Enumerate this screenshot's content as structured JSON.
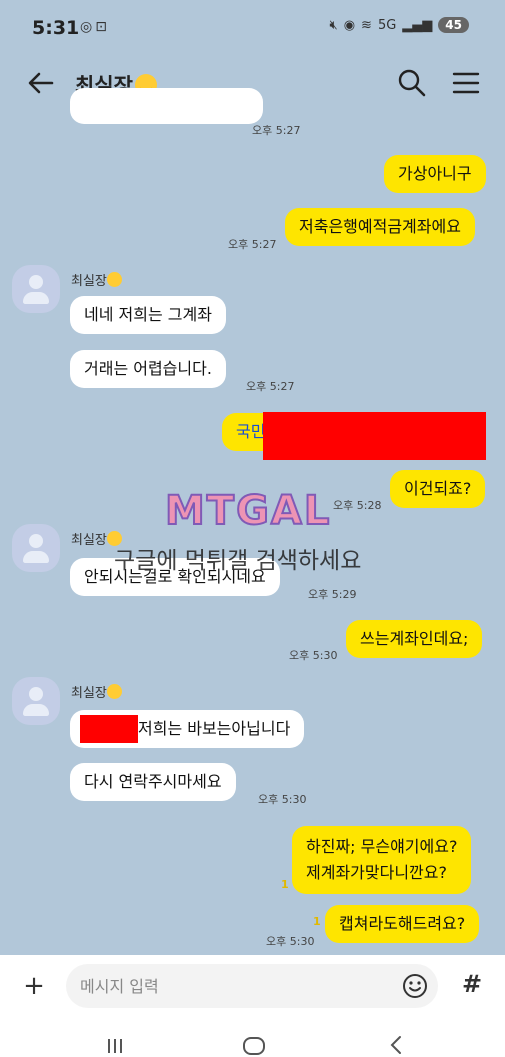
{
  "status_bar": {
    "time": "5:31",
    "left_icons": [
      "chrome-icon",
      "screenshot-icon"
    ],
    "right_icons": [
      "mute-icon",
      "hotspot-icon",
      "wifi-icon",
      "5g-icon",
      "signal-icon"
    ],
    "network": "5G",
    "battery": "45"
  },
  "header": {
    "title": "최실장",
    "icons": [
      "back-arrow-icon",
      "search-icon",
      "menu-icon"
    ]
  },
  "messages": {
    "m0_time": "오후 5:27",
    "m1_text": "가상아니구",
    "m2_text": "저축은행예적금계좌에요",
    "m2_time": "오후 5:27",
    "sender_name": "최실장",
    "m3_text": "네네 저희는 그계좌",
    "m4_text": "거래는 어렵습니다.",
    "m4_time": "오후 5:27",
    "m5_text": "국민",
    "m6_text": "이건되죠?",
    "m6_time": "오후 5:28",
    "m7_text": "안되시는걸로 확인되시네요",
    "m7_time": "오후 5:29",
    "m8_text": "쓰는계좌인데요;",
    "m8_time": "오후 5:30",
    "m9_text": "저희는 바보는아닙니다",
    "m10_text": "다시 연락주시마세요",
    "m10_time": "오후 5:30",
    "m11_line1": "하진짜; 무슨얘기에요?",
    "m11_line2": "제계좌가맞다니깐요?",
    "m11_unread": "1",
    "m12_text": "캡쳐라도해드려요?",
    "m12_unread": "1",
    "m12_time": "오후 5:30"
  },
  "watermark": {
    "logo": "MTGAL",
    "text": "구글에 먹튀갤 검색하세요"
  },
  "input": {
    "placeholder": "메시지 입력",
    "plus_label": "+",
    "hash_label": "#"
  },
  "colors": {
    "chat_bg": "#b2c7d9",
    "my_bubble": "#fee500",
    "their_bubble": "#ffffff",
    "redaction": "#ff0000"
  }
}
